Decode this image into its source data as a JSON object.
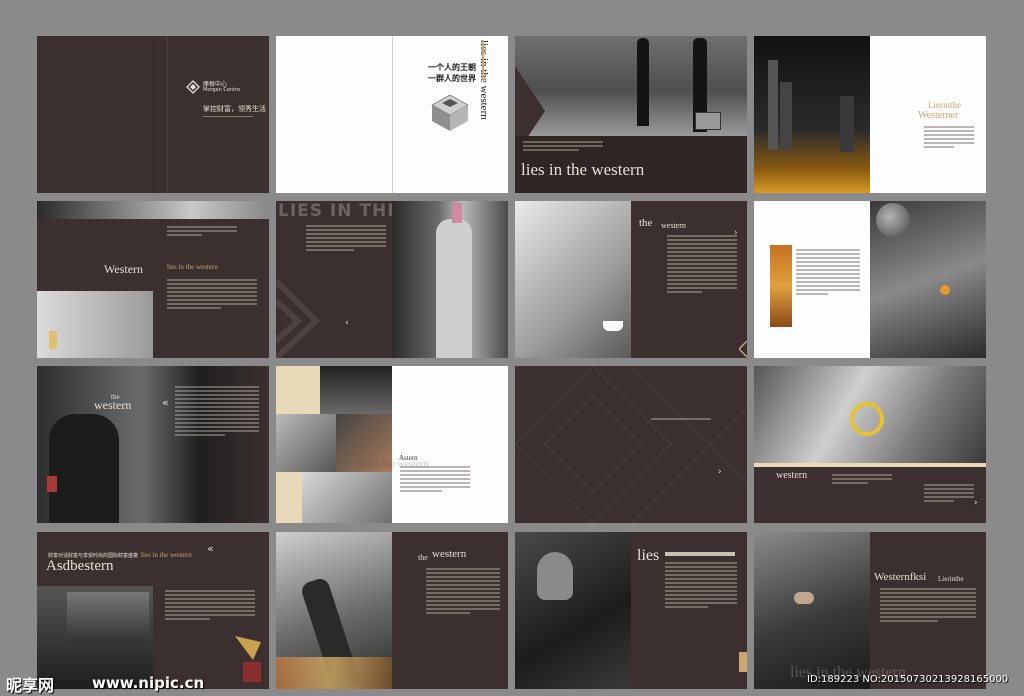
{
  "spreads": {
    "r1c1": {
      "brand_cn": "摩根中心",
      "brand_en": "Morgan Centre",
      "slogan": "掌控财富，领秀生活"
    },
    "r1c2": {
      "headline1": "一个人的王朝",
      "headline2": "一群人的世界",
      "vertical_text": "lies in the western"
    },
    "r1c3": {
      "title": "lies in  the western"
    },
    "r1c4": {
      "title1": "Lierinthe",
      "title2": "Westerner"
    },
    "r2c1": {
      "title": "Western",
      "subtitle": "lies in the western"
    },
    "r2c2": {
      "big_title": "LIES IN THE WESTERN"
    },
    "r2c3": {
      "title1": "the",
      "title2": "western"
    },
    "r3c1": {
      "title1": "the",
      "title2": "western"
    },
    "r3c2": {
      "title": "Astern",
      "ghost": "lies in the western"
    },
    "r3c4": {
      "title": "western"
    },
    "r4c1": {
      "cn_line": "财富对话财富与享受时尚的国际财富盛宴",
      "tag": "lies in the western",
      "title": "Asdbestern"
    },
    "r4c2": {
      "title1": "the",
      "title2": "western"
    },
    "r4c3": {
      "title": "lies"
    },
    "r4c4": {
      "title1": "Westernfksi",
      "title2": "Lierinthe",
      "ghost": "lies in the western"
    }
  },
  "watermark": {
    "logo_cn": "昵享网",
    "site": "www.nipic.cn",
    "id_text": "ID:189223 NO:20150730213928165000"
  },
  "colors": {
    "background": "#8a8a8a",
    "page_dark": "#3b302f",
    "accent_gold": "#c8a770"
  }
}
